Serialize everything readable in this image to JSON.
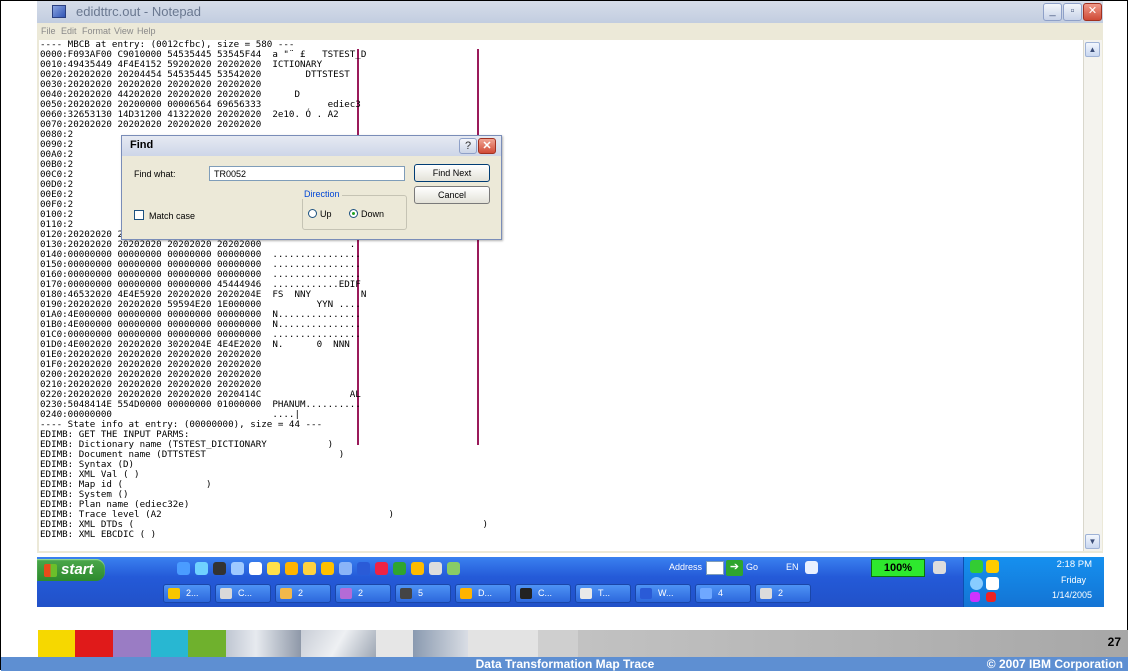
{
  "window": {
    "title": "edidttrc.out - Notepad",
    "menu": [
      "File",
      "Edit",
      "Format",
      "View",
      "Help"
    ],
    "buttons": {
      "minimize": "_",
      "maximize": "▫",
      "close": "✕"
    }
  },
  "editor": {
    "lines": [
      "---- MBCB at entry: (0012cfbc), size = 580 ---",
      "0000:F093AF00 C9010000 54535445 53545F44  a \"¨ £   TSTEST_D",
      "0010:49435449 4F4E4152 59202020 20202020  ICTIONARY",
      "0020:20202020 20204454 54535445 53542020        DTTSTEST",
      "0030:20202020 20202020 20202020 20202020",
      "0040:20202020 44202020 20202020 20202020      D",
      "0050:20202020 20200000 00006564 69656333            ediec3",
      "0060:32653130 14D31200 41322020 20202020  2e10. Ó . A2",
      "0070:20202020 20202020 20202020 20202020",
      "0080:2",
      "0090:2",
      "00A0:2",
      "00B0:2",
      "00C0:2",
      "00D0:2",
      "00E0:2",
      "00F0:2",
      "0100:2",
      "0110:2",
      "0120:20202020 20202020 20202020 20202020",
      "0130:20202020 20202020 20202020 20202000                .",
      "0140:00000000 00000000 00000000 00000000  ................",
      "0150:00000000 00000000 00000000 00000000  ................",
      "0160:00000000 00000000 00000000 00000000  ................",
      "0170:00000000 00000000 00000000 45444946  ............EDIF",
      "0180:46532020 4E4E5920 20202020 2020204E  FS  NNY         N",
      "0190:20202020 20202020 59594E20 1E000000          YYN ....",
      "01A0:4E000000 00000000 00000000 00000000  N...............",
      "01B0:4E000000 00000000 00000000 00000000  N...............",
      "01C0:00000000 00000000 00000000 00000000  ................",
      "01D0:4E002020 20202020 3020204E 4E4E2020  N.      0  NNN",
      "01E0:20202020 20202020 20202020 20202020",
      "01F0:20202020 20202020 20202020 20202020",
      "0200:20202020 20202020 20202020 20202020",
      "0210:20202020 20202020 20202020 20202020",
      "0220:20202020 20202020 20202020 2020414C                AL",
      "0230:5048414E 554D0000 00000000 01000000  PHANUM..........",
      "0240:00000000                             ....|",
      "---- State info at entry: (00000000), size = 44 ---",
      "EDIMB: GET THE INPUT PARMS:",
      "EDIMB: Dictionary name (TSTEST_DICTIONARY           )",
      "EDIMB: Document name (DTTSTEST                        )",
      "EDIMB: Syntax (D)",
      "EDIMB: XML Val ( )",
      "EDIMB: Map id (               )",
      "EDIMB: System ()",
      "EDIMB: Plan name (ediec32e)",
      "EDIMB: Trace level (A2                                         )",
      "EDIMB: XML DTDs (                                                               )",
      "EDIMB: XML EBCDIC ( )"
    ]
  },
  "find_dialog": {
    "title": "Find",
    "help": "?",
    "close": "✕",
    "find_what_label": "Find what:",
    "find_what_value": "TR0052",
    "find_next": "Find Next",
    "cancel": "Cancel",
    "direction_label": "Direction",
    "up_label": "Up",
    "down_label": "Down",
    "direction_selected": "Down",
    "match_case_label": "Match case",
    "match_case_checked": false
  },
  "taskbar": {
    "start": "start",
    "address_label": "Address",
    "go_label": "Go",
    "lang": "EN",
    "zoom": "100%",
    "clock_time": "2:18 PM",
    "clock_day": "Friday",
    "clock_date": "1/14/2005",
    "buttons": [
      {
        "label": "2...",
        "color": "#f7c600"
      },
      {
        "label": "C...",
        "color": "#d9d9d9"
      },
      {
        "label": "2",
        "color": "#f2b84a"
      },
      {
        "label": "2",
        "color": "#b56bd6"
      },
      {
        "label": "5",
        "color": "#444444"
      },
      {
        "label": "D...",
        "color": "#ffb400"
      },
      {
        "label": "C...",
        "color": "#222222"
      },
      {
        "label": "T...",
        "color": "#e9e9e9"
      },
      {
        "label": "W...",
        "color": "#2a5bd7"
      },
      {
        "label": "4",
        "color": "#6fa8ff"
      },
      {
        "label": "2",
        "color": "#dcdcdc"
      }
    ]
  },
  "slide": {
    "footer_title": "Data Transformation Map Trace",
    "copyright": "© 2007 IBM Corporation",
    "page_number": "27"
  },
  "colors": {
    "footer_bar": "#5e8fd2",
    "dump_divider": "#9a1a5a",
    "taskbar": "#245ad8"
  }
}
